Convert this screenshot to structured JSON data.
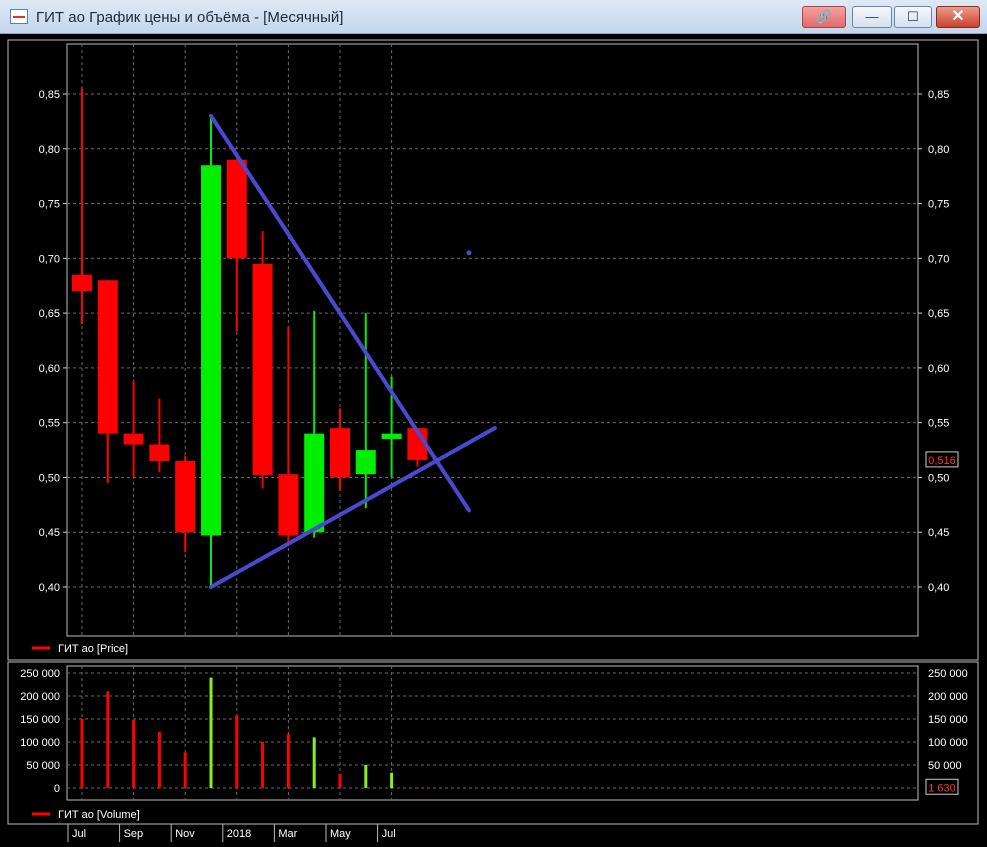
{
  "window": {
    "title": "ГИТ ао График цены и объёма - [Месячный]",
    "buttons": {
      "link": "🔗",
      "minimize": "—",
      "maximize": "☐",
      "close": "✕"
    }
  },
  "price_panel": {
    "legend": "ГИТ ао [Price]",
    "last_value_label": "0,516",
    "tick_labels": [
      "0,85",
      "0,80",
      "0,75",
      "0,70",
      "0,65",
      "0,60",
      "0,55",
      "0,50",
      "0,45",
      "0,40"
    ]
  },
  "volume_panel": {
    "legend": "ГИТ ао [Volume]",
    "last_value_label": "1 630",
    "tick_labels": [
      "250 000",
      "200 000",
      "150 000",
      "100 000",
      "50 000",
      "0"
    ]
  },
  "x_axis": {
    "labels": [
      "Jul",
      "Sep",
      "Nov",
      "2018",
      "Mar",
      "May",
      "Jul"
    ]
  },
  "colors": {
    "up": "#00ee00",
    "down": "#ff0000",
    "trendline": "#4a4ad0",
    "grid": "#6a6a6a",
    "text": "#ffffff"
  },
  "chart_data": [
    {
      "type": "candlestick",
      "title": "ГИТ ао [Price]",
      "series_name": "ГИТ ао [Price]",
      "ylim": [
        0.4,
        0.85
      ],
      "grid": true,
      "last_value": 0.516,
      "candles": [
        {
          "x": "2017-07",
          "open": 0.685,
          "high": 0.855,
          "low": 0.64,
          "close": 0.67
        },
        {
          "x": "2017-08",
          "open": 0.68,
          "high": 0.68,
          "low": 0.495,
          "close": 0.54
        },
        {
          "x": "2017-09",
          "open": 0.54,
          "high": 0.588,
          "low": 0.5,
          "close": 0.53
        },
        {
          "x": "2017-10",
          "open": 0.53,
          "high": 0.572,
          "low": 0.505,
          "close": 0.515
        },
        {
          "x": "2017-11",
          "open": 0.515,
          "high": 0.52,
          "low": 0.432,
          "close": 0.45
        },
        {
          "x": "2017-12",
          "open": 0.447,
          "high": 0.828,
          "low": 0.4,
          "close": 0.785
        },
        {
          "x": "2018-01",
          "open": 0.79,
          "high": 0.79,
          "low": 0.633,
          "close": 0.7
        },
        {
          "x": "2018-02",
          "open": 0.695,
          "high": 0.725,
          "low": 0.49,
          "close": 0.502
        },
        {
          "x": "2018-03",
          "open": 0.503,
          "high": 0.638,
          "low": 0.438,
          "close": 0.447
        },
        {
          "x": "2018-04",
          "open": 0.45,
          "high": 0.652,
          "low": 0.445,
          "close": 0.54
        },
        {
          "x": "2018-05",
          "open": 0.545,
          "high": 0.563,
          "low": 0.488,
          "close": 0.5
        },
        {
          "x": "2018-06",
          "open": 0.503,
          "high": 0.65,
          "low": 0.472,
          "close": 0.525
        },
        {
          "x": "2018-07",
          "open": 0.535,
          "high": 0.592,
          "low": 0.5,
          "close": 0.54
        },
        {
          "x": "2018-08",
          "open": 0.545,
          "high": 0.545,
          "low": 0.51,
          "close": 0.516
        }
      ],
      "trendlines": [
        {
          "from": {
            "x": "2017-12",
            "y": 0.83
          },
          "to": {
            "x": "2018-10",
            "y": 0.47
          }
        },
        {
          "from": {
            "x": "2017-12",
            "y": 0.4
          },
          "to": {
            "x": "2018-11",
            "y": 0.545
          }
        }
      ],
      "dot": {
        "x": "2018-10",
        "y": 0.705
      }
    },
    {
      "type": "bar",
      "title": "ГИТ ао [Volume]",
      "series_name": "ГИТ ао [Volume]",
      "ylim": [
        0,
        250000
      ],
      "grid": true,
      "last_value": 1630,
      "categories": [
        "2017-07",
        "2017-08",
        "2017-09",
        "2017-10",
        "2017-11",
        "2017-12",
        "2018-01",
        "2018-02",
        "2018-03",
        "2018-04",
        "2018-05",
        "2018-06",
        "2018-07",
        "2018-08"
      ],
      "values": [
        150000,
        210000,
        148000,
        122000,
        77000,
        240000,
        158000,
        100000,
        117000,
        110000,
        30000,
        50000,
        33000,
        1630
      ],
      "direction": [
        "down",
        "down",
        "down",
        "down",
        "down",
        "up",
        "down",
        "down",
        "down",
        "up",
        "down",
        "up",
        "up",
        "down"
      ]
    }
  ]
}
